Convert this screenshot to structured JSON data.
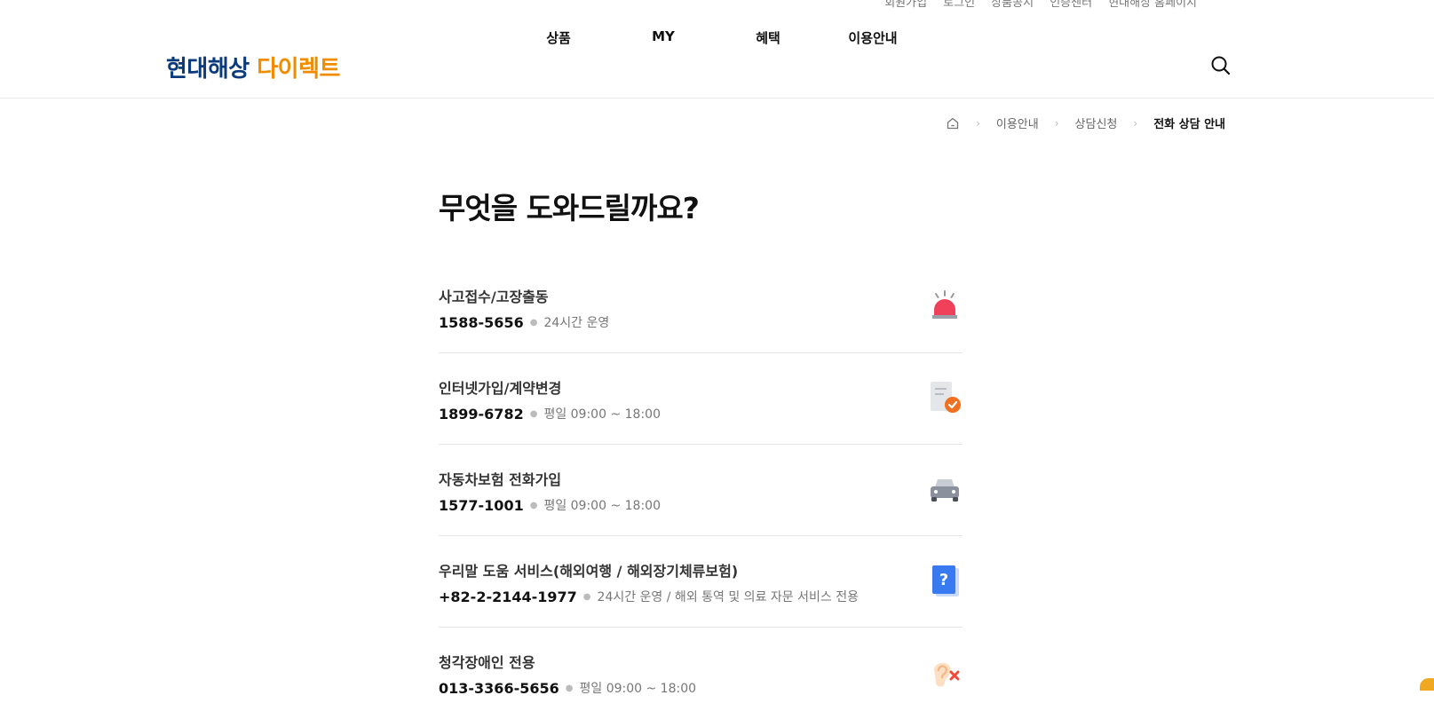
{
  "util_nav": [
    "회원가입",
    "로그인",
    "상품공시",
    "인증센터",
    "현대해상 홈페이지"
  ],
  "logo": {
    "part1": "현대해상",
    "part2": "다이렉트"
  },
  "gnb": [
    "상품",
    "MY",
    "혜택",
    "이용안내"
  ],
  "breadcrumb": {
    "items": [
      "이용안내",
      "상담신청"
    ],
    "current": "전화 상담 안내"
  },
  "page_title": "무엇을 도와드릴까요?",
  "contacts": [
    {
      "name": "사고접수/고장출동",
      "phone": "1588-5656",
      "hours": "24시간 운영",
      "icon": "siren-icon"
    },
    {
      "name": "인터넷가입/계약변경",
      "phone": "1899-6782",
      "hours": "평일 09:00 ~ 18:00",
      "icon": "document-check-icon"
    },
    {
      "name": "자동차보험 전화가입",
      "phone": "1577-1001",
      "hours": "평일 09:00 ~ 18:00",
      "icon": "car-icon"
    },
    {
      "name": "우리말 도움 서비스(해외여행 / 해외장기체류보험)",
      "phone": "+82-2-2144-1977",
      "hours": "24시간 운영 / 해외 통역 및 의료 자문 서비스 전용",
      "icon": "question-book-icon"
    },
    {
      "name": "청각장애인 전용",
      "phone": "013-3366-5656",
      "hours": "평일 09:00 ~ 18:00",
      "icon": "ear-x-icon"
    }
  ],
  "colors": {
    "brand_navy": "#0a3a7a",
    "brand_orange": "#f08c00",
    "siren_red": "#f0405a",
    "check_orange": "#f07020",
    "book_blue": "#3a7af0"
  }
}
